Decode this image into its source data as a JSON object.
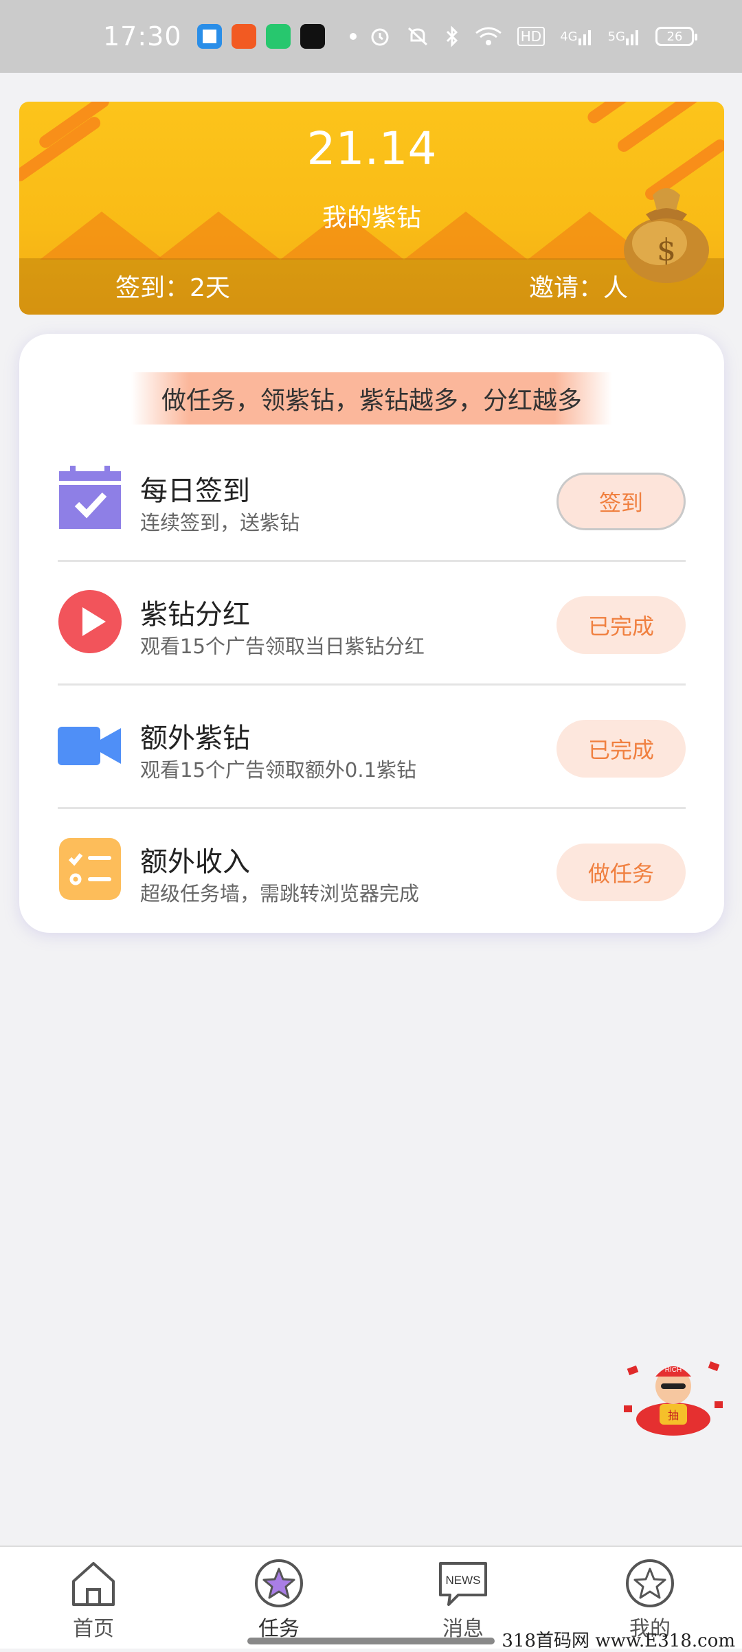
{
  "status_bar": {
    "time": "17:30",
    "hd_label": "HD",
    "network_4g": "4G",
    "network_5g": "5G",
    "battery": "26"
  },
  "banner": {
    "value": "21.14",
    "label": "我的紫钻",
    "sign_days": "签到：2天",
    "invite": "邀请：人"
  },
  "card": {
    "slogan": "做任务，领紫钻，紫钻越多，分红越多",
    "tasks": [
      {
        "title": "每日签到",
        "desc": "连续签到，送紫钻",
        "button": "签到",
        "icon": "calendar-check-icon"
      },
      {
        "title": "紫钻分红",
        "desc": "观看15个广告领取当日紫钻分红",
        "button": "已完成",
        "icon": "play-icon"
      },
      {
        "title": "额外紫钻",
        "desc": "观看15个广告领取额外0.1紫钻",
        "button": "已完成",
        "icon": "video-camera-icon"
      },
      {
        "title": "额外收入",
        "desc": "超级任务墙，需跳转浏览器完成",
        "button": "做任务",
        "icon": "task-list-icon"
      }
    ]
  },
  "bottom_nav": {
    "items": [
      {
        "label": "首页",
        "icon": "home-icon"
      },
      {
        "label": "任务",
        "icon": "star-circle-icon"
      },
      {
        "label": "消息",
        "icon": "news-icon",
        "badge_text": "NEWS"
      },
      {
        "label": "我的",
        "icon": "star-outline-icon"
      }
    ],
    "active": "任务"
  },
  "watermark": "318首码网  www.E318.com",
  "mascot_text": "RICH",
  "mascot_hongbao": "抽",
  "colors": {
    "accent": "#f08040",
    "banner": "#fcc41b",
    "purple": "#8e7fe6",
    "red": "#f2545b",
    "blue": "#4f8ff7",
    "orange": "#fdbd5a"
  }
}
